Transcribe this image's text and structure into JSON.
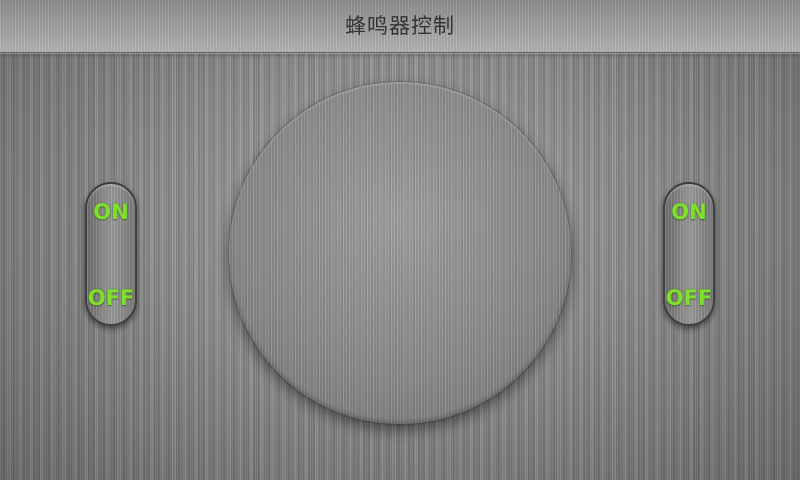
{
  "header": {
    "title": "蜂鸣器控制"
  },
  "left_switch": {
    "on_label": "ON",
    "off_label": "OFF"
  },
  "right_switch": {
    "on_label": "ON",
    "off_label": "OFF"
  },
  "colors": {
    "label_green": "#7ee02a",
    "brushed_metal": "#8a8a8a"
  }
}
